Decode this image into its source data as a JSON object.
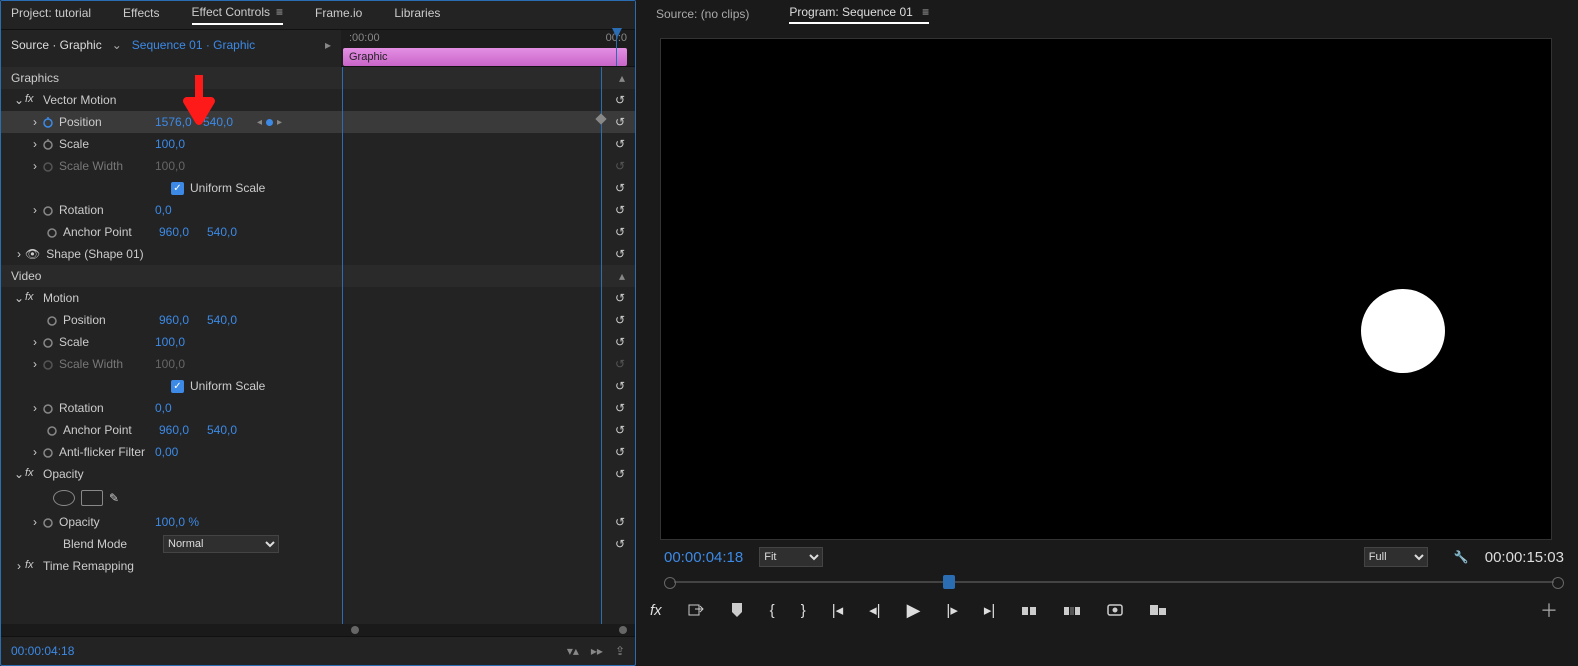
{
  "left_tabs": {
    "project": "Project: tutorial",
    "effects": "Effects",
    "effect_controls": "Effect Controls",
    "frameio": "Frame.io",
    "libraries": "Libraries"
  },
  "breadcrumb": {
    "source": "Source · Graphic",
    "sequence": "Sequence 01 · Graphic"
  },
  "timeline": {
    "start": ":00:00",
    "end": "00:0",
    "clip": "Graphic"
  },
  "sections": {
    "graphics": "Graphics",
    "video": "Video"
  },
  "vector_motion": {
    "title": "Vector Motion",
    "position": {
      "label": "Position",
      "x": "1576,0",
      "y": "540,0"
    },
    "scale": {
      "label": "Scale",
      "v": "100,0"
    },
    "scale_width": {
      "label": "Scale Width",
      "v": "100,0"
    },
    "uniform": "Uniform Scale",
    "rotation": {
      "label": "Rotation",
      "v": "0,0"
    },
    "anchor": {
      "label": "Anchor Point",
      "x": "960,0",
      "y": "540,0"
    }
  },
  "shape": {
    "label": "Shape (Shape 01)"
  },
  "motion": {
    "title": "Motion",
    "position": {
      "label": "Position",
      "x": "960,0",
      "y": "540,0"
    },
    "scale": {
      "label": "Scale",
      "v": "100,0"
    },
    "scale_width": {
      "label": "Scale Width",
      "v": "100,0"
    },
    "uniform": "Uniform Scale",
    "rotation": {
      "label": "Rotation",
      "v": "0,0"
    },
    "anchor": {
      "label": "Anchor Point",
      "x": "960,0",
      "y": "540,0"
    },
    "antiflicker": {
      "label": "Anti-flicker Filter",
      "v": "0,00"
    }
  },
  "opacity": {
    "title": "Opacity",
    "opacity": {
      "label": "Opacity",
      "v": "100,0 %"
    },
    "blend": {
      "label": "Blend Mode",
      "v": "Normal"
    }
  },
  "time_remap": "Time Remapping",
  "left_tc": "00:00:04:18",
  "right_tabs": {
    "source": "Source: (no clips)",
    "program": "Program: Sequence 01"
  },
  "program": {
    "tc": "00:00:04:18",
    "fit": "Fit",
    "res": "Full",
    "dur": "00:00:15:03"
  },
  "transport_icons": [
    "fx",
    "insert",
    "marker",
    "in",
    "out",
    "goto-in",
    "step-back",
    "play",
    "step-fwd",
    "goto-out",
    "lift",
    "extract",
    "snapshot",
    "overlay"
  ]
}
